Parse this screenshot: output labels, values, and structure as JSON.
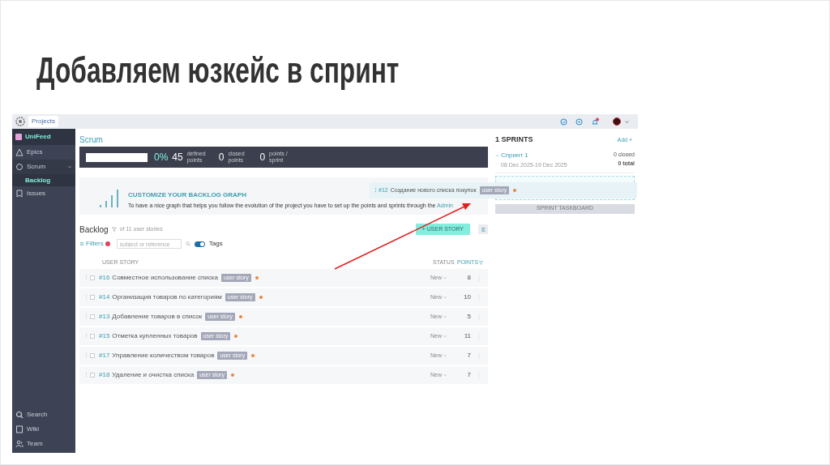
{
  "slide": {
    "title": "Добавляем юзкейс в спринт"
  },
  "topbar": {
    "projects_button": "Projects"
  },
  "sidebar": {
    "project": "UniFeed",
    "items": [
      {
        "kind": "epics",
        "label": "Epics",
        "selected": false
      },
      {
        "kind": "scrum",
        "label": "Scrum",
        "selected": false,
        "expanded": true,
        "children": [
          {
            "label": "Backlog",
            "selected": true
          }
        ]
      },
      {
        "kind": "issues",
        "label": "Issues",
        "selected": false
      }
    ],
    "footer_items": [
      {
        "kind": "search",
        "label": "Search"
      },
      {
        "kind": "wiki",
        "label": "Wiki"
      },
      {
        "kind": "team",
        "label": "Team"
      }
    ]
  },
  "main": {
    "title": "Scrum",
    "progress": {
      "level": 0,
      "percent": "0%"
    },
    "stats": [
      {
        "value": "45",
        "label": "defined points"
      },
      {
        "value": "0",
        "label": "closed points"
      },
      {
        "value": "0",
        "label": "points / sprint"
      }
    ],
    "banner": {
      "title": "CUSTOMIZE YOUR BACKLOG GRAPH",
      "text": "To have a nice graph that helps you follow the evolution of the project you have to set up the points and sprints through the",
      "link": "Admin"
    },
    "backlog": {
      "title": "Backlog",
      "count": "of 11 user stories",
      "filters": "Filters",
      "search_placeholder": "subject or reference",
      "tags_toggle": {
        "label": "Tags",
        "on": true
      },
      "add_button": "+ USER STORY",
      "columns": [
        "USER STORY",
        "STATUS",
        "POINTS"
      ],
      "rows": [
        {
          "ref": "#16",
          "subject": "Совместное использование списка",
          "tag": "user story",
          "status": "New",
          "points": "8",
          "checked": false
        },
        {
          "ref": "#14",
          "subject": "Организация товаров по категориям",
          "tag": "user story",
          "status": "New",
          "points": "10",
          "checked": false
        },
        {
          "ref": "#13",
          "subject": "Добавление товаров в список",
          "tag": "user story",
          "status": "New",
          "points": "5",
          "checked": false
        },
        {
          "ref": "#15",
          "subject": "Отметка купленных товаров",
          "tag": "user story",
          "status": "New",
          "points": "11",
          "checked": false
        },
        {
          "ref": "#17",
          "subject": "Управление количеством товаров",
          "tag": "user story",
          "status": "New",
          "points": "7",
          "checked": false
        },
        {
          "ref": "#18",
          "subject": "Удаление и очистка списка",
          "tag": "user story",
          "status": "New",
          "points": "7",
          "checked": false
        }
      ]
    },
    "dragged_story": {
      "ref": "#12",
      "subject": "Создание нового списка покупок",
      "tag": "user story"
    }
  },
  "sprints": {
    "title": "1 SPRINTS",
    "add": "Add +",
    "items": [
      {
        "name": "Спринт 1",
        "dates": "08 Dec 2025-19 Dec 2025",
        "closed": "0 closed",
        "total": "0 total",
        "expanded": true
      }
    ],
    "taskboard_button": "SPRINT TASKBOARD"
  }
}
